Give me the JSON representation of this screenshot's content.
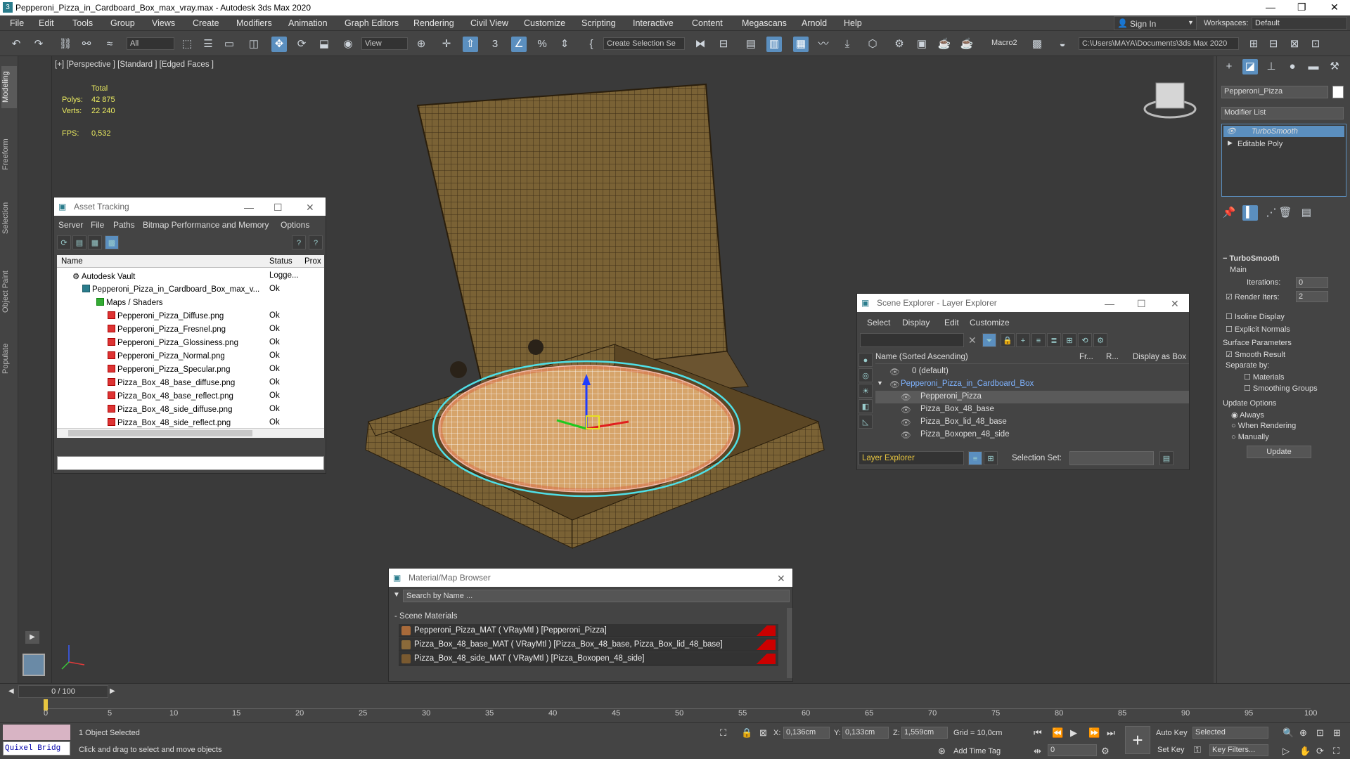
{
  "window": {
    "title": "Pepperoni_Pizza_in_Cardboard_Box_max_vray.max - Autodesk 3ds Max 2020"
  },
  "menu": [
    "File",
    "Edit",
    "Tools",
    "Group",
    "Views",
    "Create",
    "Modifiers",
    "Animation",
    "Graph Editors",
    "Rendering",
    "Civil View",
    "Customize",
    "Scripting",
    "Interactive",
    "Content",
    "Megascans",
    "Arnold",
    "Help"
  ],
  "account": {
    "sign_in": "Sign In",
    "workspaces_label": "Workspaces:",
    "workspace": "Default"
  },
  "toolbar": {
    "filter": "All",
    "ref_coord": "View",
    "selection_set": "Create Selection Se",
    "macro": "Macro2",
    "project_path": "C:\\Users\\MAYA\\Documents\\3ds Max 2020"
  },
  "left_tabs": [
    "Modeling",
    "Freeform",
    "Selection",
    "Object Paint",
    "Populate"
  ],
  "viewport": {
    "label": "[+] [Perspective ] [Standard ] [Edged Faces ]",
    "stats": {
      "total_label": "Total",
      "polys_label": "Polys:",
      "polys": "42 875",
      "verts_label": "Verts:",
      "verts": "22 240",
      "fps_label": "FPS:",
      "fps": "0,532"
    }
  },
  "asset_tracking": {
    "title": "Asset Tracking",
    "menu": [
      "Server",
      "File",
      "Paths",
      "Bitmap Performance and Memory",
      "Options"
    ],
    "columns": [
      "Name",
      "Status",
      "Prox"
    ],
    "rows": [
      {
        "name": "Autodesk Vault",
        "status": "Logge..."
      },
      {
        "name": "Pepperoni_Pizza_in_Cardboard_Box_max_v...",
        "status": "Ok"
      },
      {
        "name": "Maps / Shaders",
        "status": ""
      },
      {
        "name": "Pepperoni_Pizza_Diffuse.png",
        "status": "Ok"
      },
      {
        "name": "Pepperoni_Pizza_Fresnel.png",
        "status": "Ok"
      },
      {
        "name": "Pepperoni_Pizza_Glossiness.png",
        "status": "Ok"
      },
      {
        "name": "Pepperoni_Pizza_Normal.png",
        "status": "Ok"
      },
      {
        "name": "Pepperoni_Pizza_Specular.png",
        "status": "Ok"
      },
      {
        "name": "Pizza_Box_48_base_diffuse.png",
        "status": "Ok"
      },
      {
        "name": "Pizza_Box_48_base_reflect.png",
        "status": "Ok"
      },
      {
        "name": "Pizza_Box_48_side_diffuse.png",
        "status": "Ok"
      },
      {
        "name": "Pizza_Box_48_side_reflect.png",
        "status": "Ok"
      }
    ]
  },
  "scene_explorer": {
    "title": "Scene Explorer - Layer Explorer",
    "menu": [
      "Select",
      "Display",
      "Edit",
      "Customize"
    ],
    "columns": [
      "Name (Sorted Ascending)",
      "Fr...",
      "R...",
      "Display as Box"
    ],
    "rows": [
      "0 (default)",
      "Pepperoni_Pizza_in_Cardboard_Box",
      "Pepperoni_Pizza",
      "Pizza_Box_48_base",
      "Pizza_Box_lid_48_base",
      "Pizza_Boxopen_48_side"
    ],
    "footer": {
      "explorer": "Layer Explorer",
      "selection_set_label": "Selection Set:"
    }
  },
  "material_browser": {
    "title": "Material/Map Browser",
    "search_placeholder": "Search by Name ...",
    "section": "- Scene Materials",
    "rows": [
      "Pepperoni_Pizza_MAT  ( VRayMtl )  [Pepperoni_Pizza]",
      "Pizza_Box_48_base_MAT  ( VRayMtl )  [Pizza_Box_48_base, Pizza_Box_lid_48_base]",
      "Pizza_Box_48_side_MAT  ( VRayMtl )  [Pizza_Boxopen_48_side]"
    ]
  },
  "command_panel": {
    "object_name": "Pepperoni_Pizza",
    "modifier_list": "Modifier List",
    "stack": [
      "TurboSmooth",
      "Editable Poly"
    ],
    "rollout": "TurboSmooth",
    "main": "Main",
    "iterations_label": "Iterations:",
    "iterations": "0",
    "render_iters_label": "Render Iters:",
    "render_iters": "2",
    "isoline": "Isoline Display",
    "explicit": "Explicit Normals",
    "surface": "Surface Parameters",
    "smooth": "Smooth Result",
    "separate": "Separate by:",
    "materials": "Materials",
    "smoothing": "Smoothing Groups",
    "update_options": "Update Options",
    "always": "Always",
    "when_rendering": "When Rendering",
    "manually": "Manually",
    "update": "Update"
  },
  "timeline": {
    "frame": "0 / 100",
    "ticks": [
      "0",
      "5",
      "10",
      "15",
      "20",
      "25",
      "30",
      "35",
      "40",
      "45",
      "50",
      "55",
      "60",
      "65",
      "70",
      "75",
      "80",
      "85",
      "90",
      "95",
      "100"
    ]
  },
  "status": {
    "quixel": "Quixel Bridg",
    "selected": "1 Object Selected",
    "hint": "Click and drag to select and move objects",
    "x_label": "X:",
    "x": "0,136cm",
    "y_label": "Y:",
    "y": "0,133cm",
    "z_label": "Z:",
    "z": "1,559cm",
    "grid": "Grid = 10,0cm",
    "add_time_tag": "Add Time Tag",
    "auto_key": "Auto Key",
    "set_key": "Set Key",
    "key_mode": "Selected",
    "key_filters": "Key Filters...",
    "frame_field": "0"
  }
}
